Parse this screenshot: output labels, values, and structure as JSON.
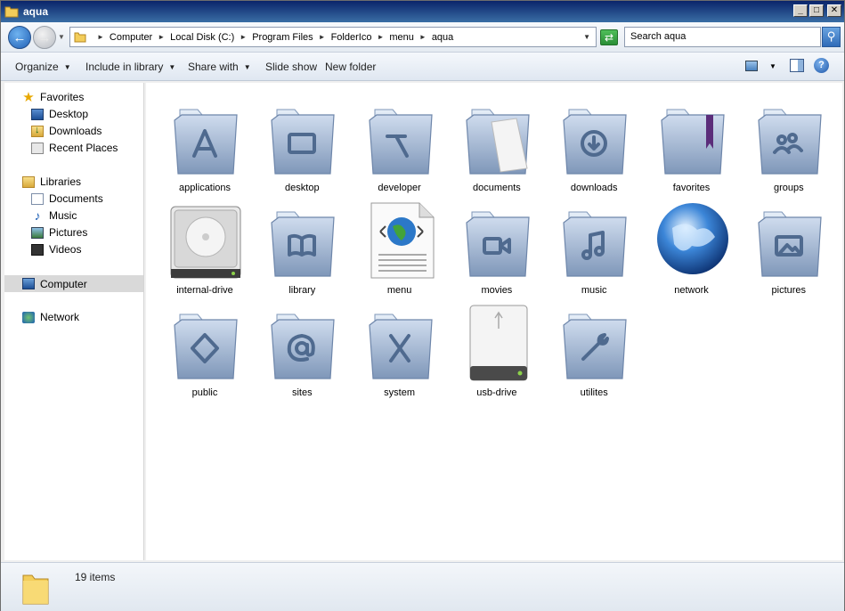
{
  "window": {
    "title": "aqua"
  },
  "address": {
    "crumbs": [
      "Computer",
      "Local Disk (C:)",
      "Program Files",
      "FolderIco",
      "menu",
      "aqua"
    ],
    "search_placeholder": "Search aqua"
  },
  "toolbar": {
    "organize": "Organize",
    "include_library": "Include in library",
    "share_with": "Share with",
    "slide_show": "Slide show",
    "new_folder": "New folder"
  },
  "nav": {
    "favorites": "Favorites",
    "desktop": "Desktop",
    "downloads": "Downloads",
    "recent_places": "Recent Places",
    "libraries": "Libraries",
    "documents": "Documents",
    "music": "Music",
    "pictures": "Pictures",
    "videos": "Videos",
    "computer": "Computer",
    "network": "Network"
  },
  "items": [
    {
      "label": "applications",
      "icon": "applications-folder-icon"
    },
    {
      "label": "desktop",
      "icon": "desktop-folder-icon"
    },
    {
      "label": "developer",
      "icon": "developer-folder-icon"
    },
    {
      "label": "documents",
      "icon": "documents-folder-icon"
    },
    {
      "label": "downloads",
      "icon": "downloads-folder-icon"
    },
    {
      "label": "favorites",
      "icon": "favorites-folder-icon"
    },
    {
      "label": "groups",
      "icon": "groups-folder-icon"
    },
    {
      "label": "internal-drive",
      "icon": "hard-drive-icon"
    },
    {
      "label": "library",
      "icon": "library-folder-icon"
    },
    {
      "label": "menu",
      "icon": "html-document-icon"
    },
    {
      "label": "movies",
      "icon": "movies-folder-icon"
    },
    {
      "label": "music",
      "icon": "music-folder-icon"
    },
    {
      "label": "network",
      "icon": "network-globe-icon"
    },
    {
      "label": "pictures",
      "icon": "pictures-folder-icon"
    },
    {
      "label": "public",
      "icon": "public-folder-icon"
    },
    {
      "label": "sites",
      "icon": "sites-folder-icon"
    },
    {
      "label": "system",
      "icon": "system-folder-icon"
    },
    {
      "label": "usb-drive",
      "icon": "usb-drive-icon"
    },
    {
      "label": "utilites",
      "icon": "utilities-folder-icon"
    }
  ],
  "status": {
    "count_text": "19 items"
  },
  "colors": {
    "folder_light": "#cfdcee",
    "folder_dark": "#7f97b9",
    "glyph": "#4f6a8f",
    "selection": "#d9d9d9"
  }
}
